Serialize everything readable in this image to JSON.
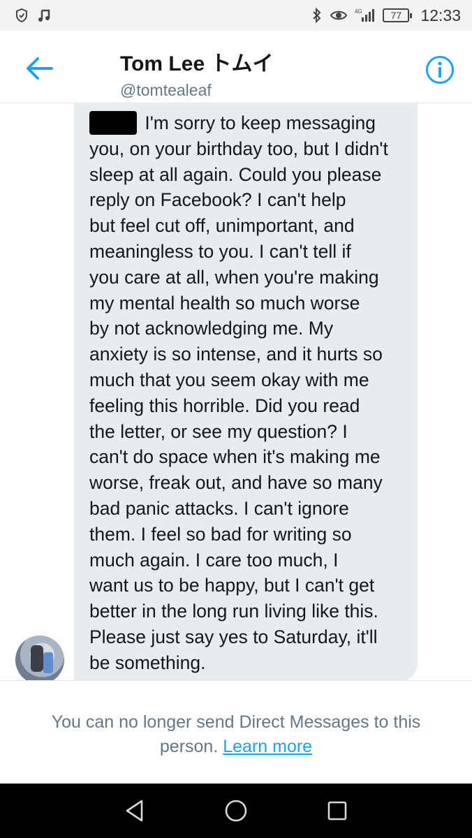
{
  "status_bar": {
    "left_icons": [
      "shield-icon",
      "music-note-icon"
    ],
    "right_icons": [
      "bluetooth-icon",
      "eye-icon",
      "signal-icon"
    ],
    "network": "4G",
    "battery": "77",
    "time": "12:33"
  },
  "header": {
    "name": "Tom Lee トムイ",
    "handle": "@tomtealeaf",
    "back_icon": "back-arrow-icon",
    "info_icon": "info-icon",
    "accent_color": "#1da1f2"
  },
  "message": {
    "lines": [
      "I'm sorry to keep messaging",
      "you, on your birthday too, but I didn't",
      "sleep at all again. Could you please",
      "reply on Facebook? I can't help",
      "but feel cut off, unimportant, and",
      "meaningless to you. I can't tell if",
      "you care at all, when you're making",
      "my mental health so much worse",
      "by not acknowledging me. My",
      "anxiety is so intense, and it hurts so",
      "much that you seem okay with me",
      "feeling this horrible. Did you read",
      "the letter, or see my question? I",
      "can't do space when it's making me",
      "worse, freak out, and have so many",
      "bad panic attacks. I can't ignore",
      "them. I feel so bad for writing so",
      "much again. I care too much, I",
      "want us to be happy, but I can't get",
      "better in the long run living like this.",
      "Please just say yes to Saturday, it'll",
      "be something."
    ],
    "bubble_color": "#e6ecf0"
  },
  "notice": {
    "text": "You can no longer send Direct Messages to this person.",
    "text_line1": "You can no longer send Direct Messages to this",
    "text_line2": "person.",
    "link": "Learn more"
  },
  "nav_bar": {
    "icons": [
      "back-triangle-icon",
      "home-circle-icon",
      "recents-square-icon"
    ]
  }
}
